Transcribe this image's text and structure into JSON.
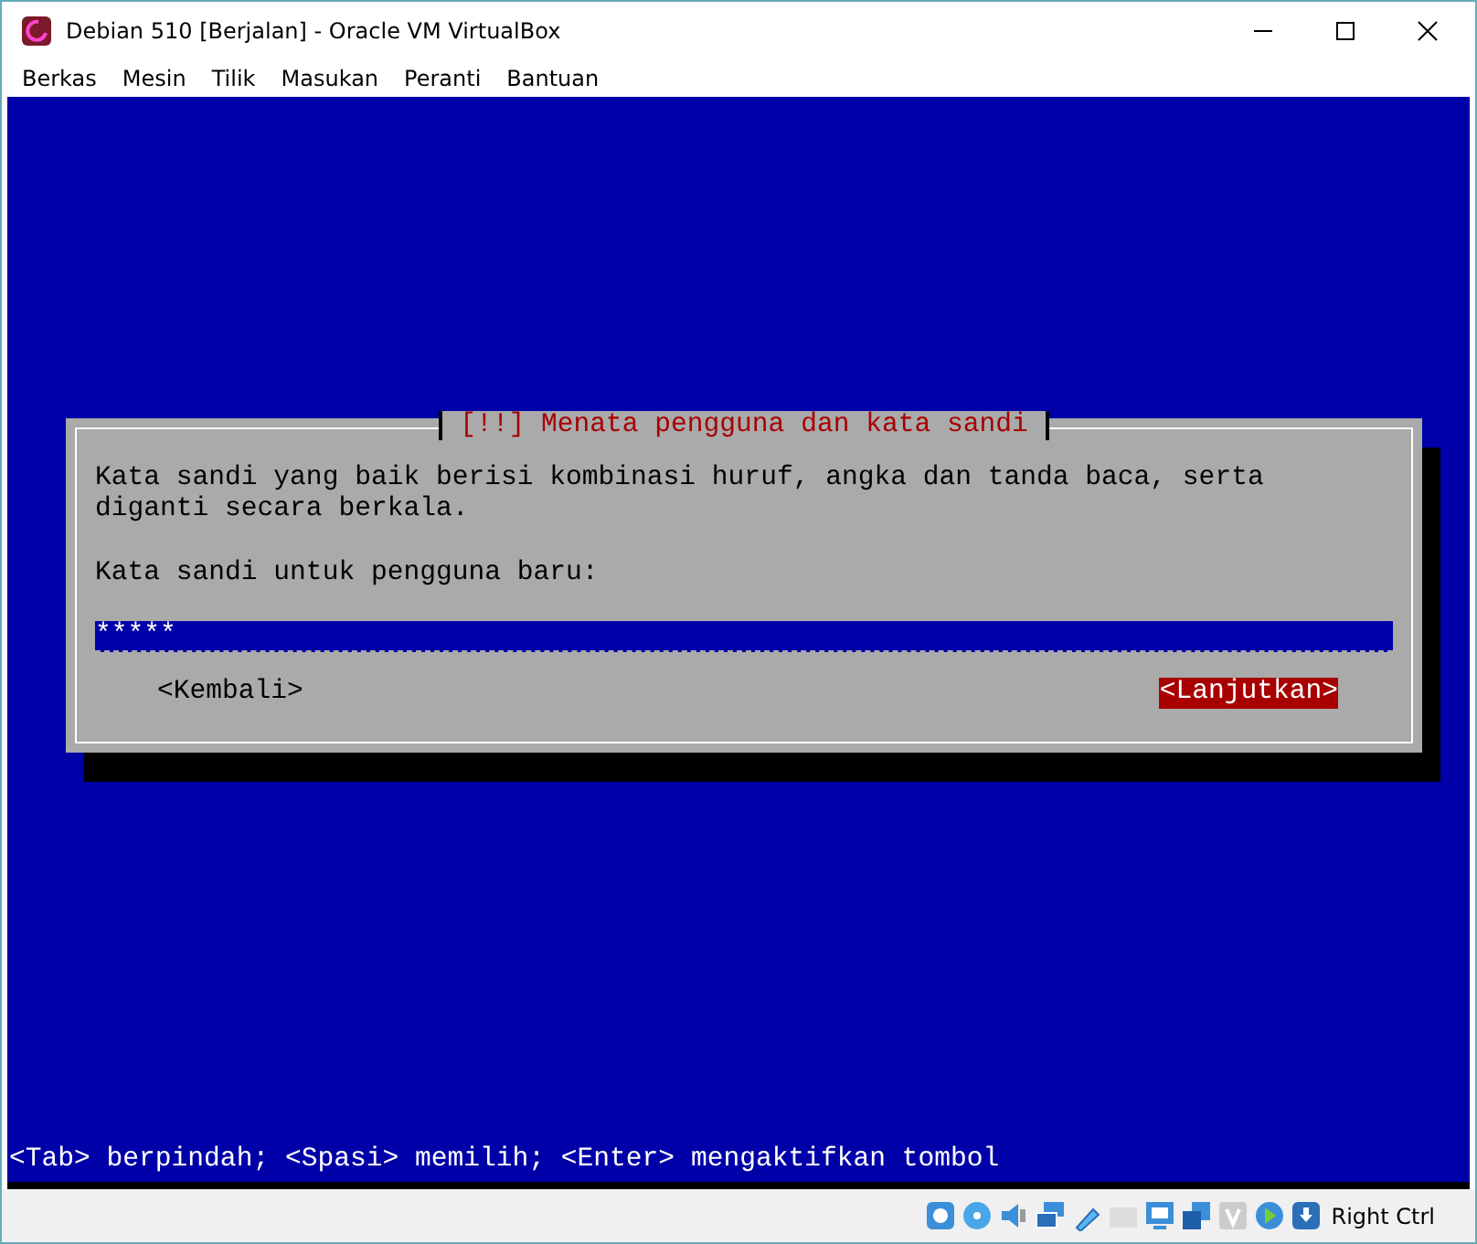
{
  "window": {
    "title": "Debian 510 [Berjalan] - Oracle VM VirtualBox"
  },
  "menu": [
    "Berkas",
    "Mesin",
    "Tilik",
    "Masukan",
    "Peranti",
    "Bantuan"
  ],
  "dialog": {
    "title": "[!!] Menata pengguna dan kata sandi",
    "message": "Kata sandi yang baik berisi kombinasi huruf, angka dan tanda baca, serta diganti secara berkala.",
    "prompt": "Kata sandi untuk pengguna baru:",
    "value": "*****",
    "buttons": [
      {
        "label": "<Kembali>",
        "selected": false
      },
      {
        "label": "<Lanjutkan>",
        "selected": true
      }
    ]
  },
  "help_line": "<Tab> berpindah; <Spasi> memilih; <Enter> mengaktifkan tombol",
  "status_bar": {
    "host_key": "Right Ctrl"
  }
}
